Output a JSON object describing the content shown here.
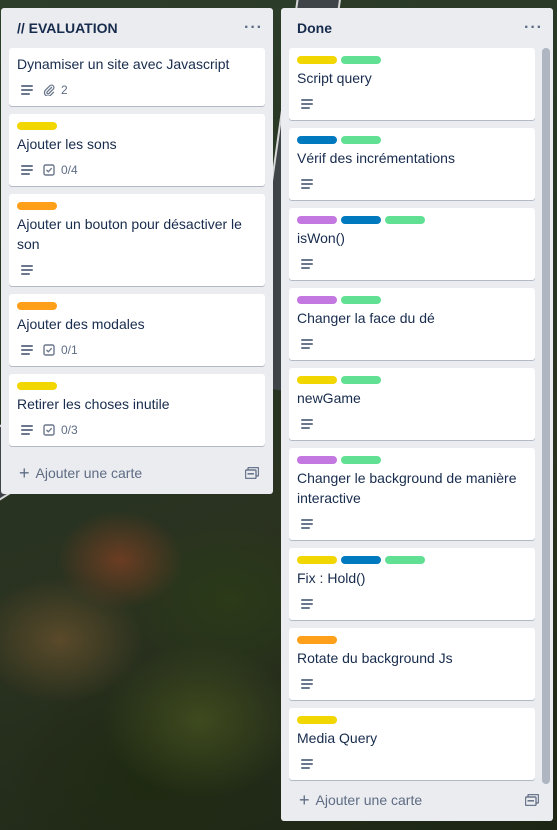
{
  "colors": {
    "yellow": "#f2d600",
    "green": "#61e094",
    "blue": "#0079bf",
    "purple": "#c377e0",
    "orange": "#ff9f1a"
  },
  "lists": {
    "evaluation": {
      "title": "// EVALUATION",
      "menu": "···",
      "add_card": "Ajouter une carte",
      "cards": [
        {
          "title": "Dynamiser un site avec Javascript",
          "labels": [],
          "description": true,
          "attachments": "2"
        },
        {
          "title": "Ajouter les sons",
          "labels": [
            "yellow"
          ],
          "description": true,
          "checklist": "0/4"
        },
        {
          "title": "Ajouter un bouton pour désactiver le son",
          "labels": [
            "orange"
          ],
          "description": true
        },
        {
          "title": "Ajouter des modales",
          "labels": [
            "orange"
          ],
          "description": true,
          "checklist": "0/1"
        },
        {
          "title": "Retirer les choses inutile",
          "labels": [
            "yellow"
          ],
          "description": true,
          "checklist": "0/3"
        }
      ]
    },
    "done": {
      "title": "Done",
      "menu": "···",
      "add_card": "Ajouter une carte",
      "cards": [
        {
          "title": "Script query",
          "labels": [
            "yellow",
            "green"
          ],
          "description": true
        },
        {
          "title": "Vérif des incrémentations",
          "labels": [
            "blue",
            "green"
          ],
          "description": true
        },
        {
          "title": "isWon()",
          "labels": [
            "purple",
            "blue",
            "green"
          ],
          "description": true
        },
        {
          "title": "Changer la face du dé",
          "labels": [
            "purple",
            "green"
          ],
          "description": true
        },
        {
          "title": "newGame",
          "labels": [
            "yellow",
            "green"
          ],
          "description": true
        },
        {
          "title": "Changer le background de manière interactive",
          "labels": [
            "purple",
            "green"
          ],
          "description": true
        },
        {
          "title": "Fix : Hold()",
          "labels": [
            "yellow",
            "blue",
            "green"
          ],
          "description": true
        },
        {
          "title": "Rotate du background Js",
          "labels": [
            "orange"
          ],
          "description": true
        },
        {
          "title": "Media Query",
          "labels": [
            "yellow"
          ],
          "description": true
        }
      ]
    }
  }
}
